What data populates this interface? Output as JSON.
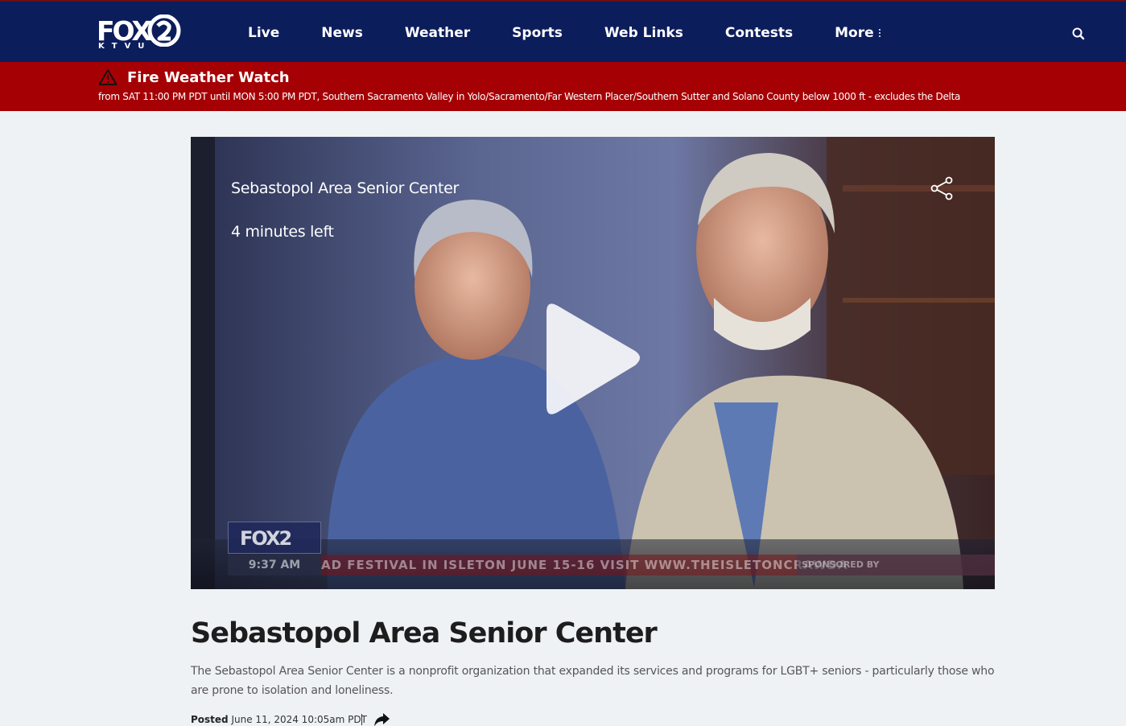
{
  "header": {
    "logo_text": "FOX",
    "logo_sub": "KTVU",
    "nav": [
      "Live",
      "News",
      "Weather",
      "Sports",
      "Web Links",
      "Contests",
      "More"
    ],
    "colors": {
      "bar": "#0c1d5c",
      "alert": "#a50004"
    }
  },
  "alert": {
    "title": "Fire Weather Watch",
    "text": "from SAT 11:00 PM PDT until MON 5:00 PM PDT, Southern Sacramento Valley in Yolo/Sacramento/Far Western Placer/Southern Sutter and Solano County below 1000 ft - excludes the Delta",
    "icon": "warning-triangle-icon"
  },
  "video": {
    "title": "Sebastopol Area Senior Center",
    "time_left": "4 minutes left",
    "bug": "FOX2",
    "clock": "9:37 AM",
    "ticker": "AD FESTIVAL IN ISLETON JUNE 15-16 VISIT WWW.THEISLETONCRAWDA",
    "sponsor": "SPONSORED BY"
  },
  "article": {
    "headline": "Sebastopol Area Senior Center",
    "dek": "The Sebastopol Area Senior Center is a nonprofit organization that expanded its services and programs for LGBT+ seniors - particularly those who are prone to isolation and loneliness.",
    "posted_label": "Posted",
    "posted_date": "June 11, 2024 10:05am PDT"
  }
}
